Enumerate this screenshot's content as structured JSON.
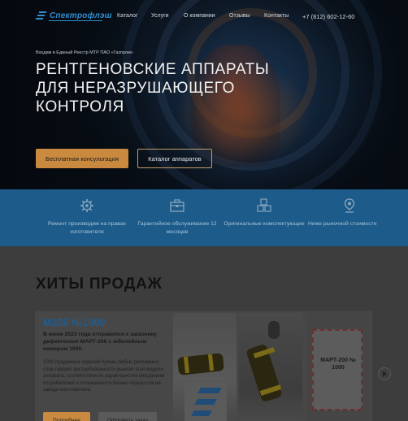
{
  "brand": {
    "logo_text": "Спектрофлэш",
    "accent": "#2f8ed0"
  },
  "nav": {
    "items": [
      "Каталог",
      "Услуги",
      "О компании",
      "Отзывы",
      "Контакты"
    ],
    "phone": "+7 (812) 602-12-60"
  },
  "hero": {
    "registry": "Входим в Единый Реестр МТР ПАО «Газпром»",
    "title": "РЕНТГЕНОВСКИЕ АППАРАТЫ ДЛЯ НЕРАЗРУШАЮЩЕГО КОНТРОЛЯ",
    "consult_button": "Бесплатная консультация",
    "catalog_button": "Каталог аппаратов",
    "button_color": "#c98a3f"
  },
  "features": [
    {
      "icon": "gear-wrench-icon",
      "text": "Ремонт производим на правах изготовителя"
    },
    {
      "icon": "toolbox-icon",
      "text": "Гарантийное обслуживание 12 месяцев"
    },
    {
      "icon": "cubes-icon",
      "text": "Оригинальные комплектующие"
    },
    {
      "icon": "price-pin-icon",
      "text": "Ниже рыночной стоимости"
    }
  ],
  "hits": {
    "title": "ХИТЫ ПРОДАЖ",
    "product": {
      "name": "М200 №1000",
      "lead": "В июне 2023 года отправился к заказчику дефектоскоп МАРТ-200 с юбилейным номером 1000.",
      "description": "1000 проданных изделий лучше любых рекламных слов говорят востребованности рынком этой модели аппарата, соответствии ее характеристик ожиданиям потребителей и отлаженности бизнес-процессов на заводе-изготовителе.",
      "details_button": "Подробнее",
      "order_button": "Оформить заказ",
      "cake_text": "МАРТ-200 № 1000"
    }
  }
}
